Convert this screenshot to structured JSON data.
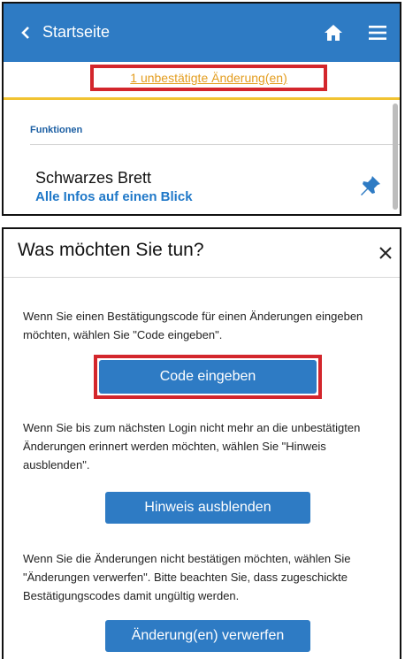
{
  "app": {
    "back_label": "Startseite",
    "notice_link": "1 unbestätigte Änderung(en)",
    "section_label": "Funktionen",
    "board_title": "Schwarzes Brett",
    "board_subtitle": "Alle Infos auf einen Blick",
    "icons": {
      "back": "chevron-left-icon",
      "home": "home-icon",
      "menu": "hamburger-menu-icon",
      "pin": "pin-icon"
    }
  },
  "dialog": {
    "title": "Was möchten Sie tun?",
    "close_icon": "close-icon",
    "para_code": "Wenn Sie einen Bestätigungscode für einen Änderungen eingeben möchten, wählen Sie \"Code eingeben\".",
    "button_code": "Code eingeben",
    "para_hint": "Wenn Sie bis zum nächsten Login nicht mehr an die unbestätigten Änderungen erinnert werden möchten, wählen Sie \"Hinweis ausblenden\".",
    "button_hint": "Hinweis ausblenden",
    "para_discard": "Wenn Sie die Änderungen nicht bestätigen möchten, wählen Sie \"Änderungen verwerfen\". Bitte beachten Sie, dass zugeschickte Bestätigungscodes damit ungültig werden.",
    "button_discard": "Änderung(en) verwerfen"
  },
  "colors": {
    "brand_blue": "#2e7bc4",
    "highlight_red": "#d3262c",
    "notice_orange": "#e39d1f",
    "notice_underline": "#f1c332"
  }
}
